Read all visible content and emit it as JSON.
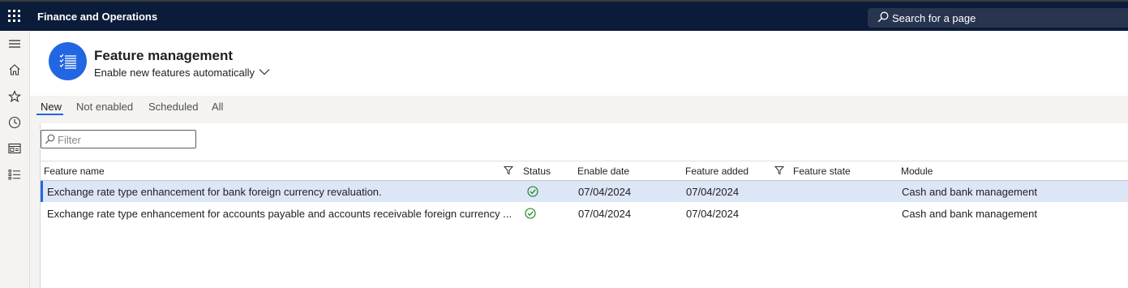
{
  "app": {
    "title": "Finance and Operations",
    "search_placeholder": "Search for a page"
  },
  "nav": {
    "icons": [
      "hamburger-icon",
      "home-icon",
      "star-icon",
      "clock-icon",
      "workspace-icon",
      "list-icon"
    ]
  },
  "workspace": {
    "title": "Feature management",
    "subtitle": "Enable new features automatically"
  },
  "tabs": [
    {
      "label": "New",
      "active": true
    },
    {
      "label": "Not enabled",
      "active": false
    },
    {
      "label": "Scheduled",
      "active": false
    },
    {
      "label": "All",
      "active": false
    }
  ],
  "filter": {
    "placeholder": "Filter"
  },
  "grid": {
    "columns": [
      "Feature name",
      "Status",
      "Enable date",
      "Feature added",
      "Feature state",
      "Module"
    ],
    "rows": [
      {
        "feature_name": "Exchange rate type enhancement for bank foreign currency revaluation.",
        "status": "check-circle-icon",
        "enable_date": "07/04/2024",
        "feature_added": "07/04/2024",
        "feature_state": "",
        "module": "Cash and bank management",
        "selected": true
      },
      {
        "feature_name": "Exchange rate type enhancement for accounts payable and accounts receivable foreign currency ...",
        "status": "check-circle-icon",
        "enable_date": "07/04/2024",
        "feature_added": "07/04/2024",
        "feature_state": "",
        "module": "Cash and bank management",
        "selected": false
      }
    ]
  },
  "colors": {
    "topbar": "#0b1b3a",
    "accent": "#2266e3",
    "selected_row": "#dce6f7",
    "status_ok": "#107c10"
  }
}
